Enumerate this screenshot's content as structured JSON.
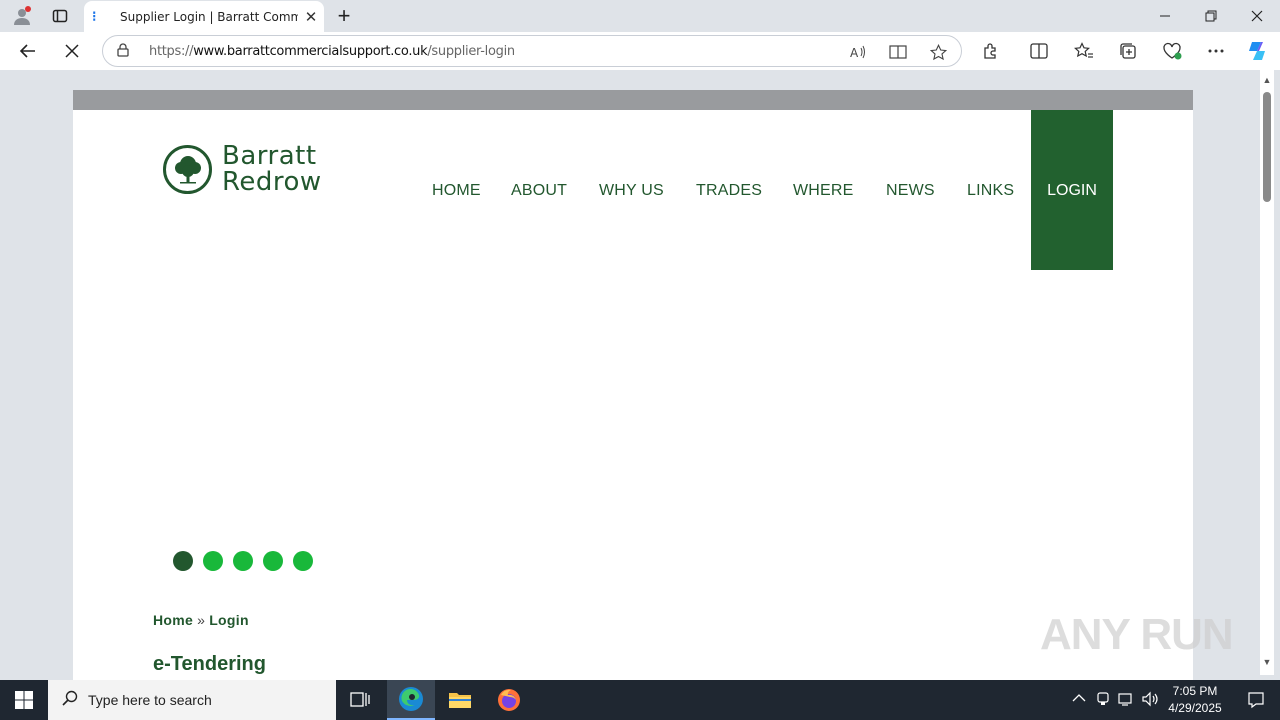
{
  "browser": {
    "tab": {
      "title": "Supplier Login | Barratt Commercial Support",
      "close_glyph": "✕"
    },
    "new_tab_glyph": "+",
    "window_controls": {
      "minimize": "—",
      "restore": "❐",
      "close": "✕"
    },
    "address": {
      "scheme": "https://",
      "host": "www.barrattcommercialsupport.co.uk",
      "path": "/supplier-login"
    }
  },
  "site": {
    "logo": {
      "line1": "Barratt",
      "line2": "Redrow"
    },
    "nav": [
      {
        "label": "HOME"
      },
      {
        "label": "ABOUT"
      },
      {
        "label": "WHY US"
      },
      {
        "label": "TRADES"
      },
      {
        "label": "WHERE"
      },
      {
        "label": "NEWS"
      },
      {
        "label": "LINKS"
      },
      {
        "label": "LOGIN",
        "active": true
      }
    ],
    "slider": {
      "count": 5,
      "active_index": 0
    },
    "breadcrumb": {
      "home": "Home",
      "separator": "»",
      "current": "Login"
    },
    "heading": "e-Tendering",
    "colors": {
      "brand_green": "#22572e",
      "login_bg": "#22612f",
      "dot_green": "#18b83a",
      "top_bar": "#999b9e"
    }
  },
  "watermark": "ANY RUN",
  "taskbar": {
    "search_placeholder": "Type here to search",
    "clock_time": "7:05 PM",
    "clock_date": "4/29/2025"
  }
}
